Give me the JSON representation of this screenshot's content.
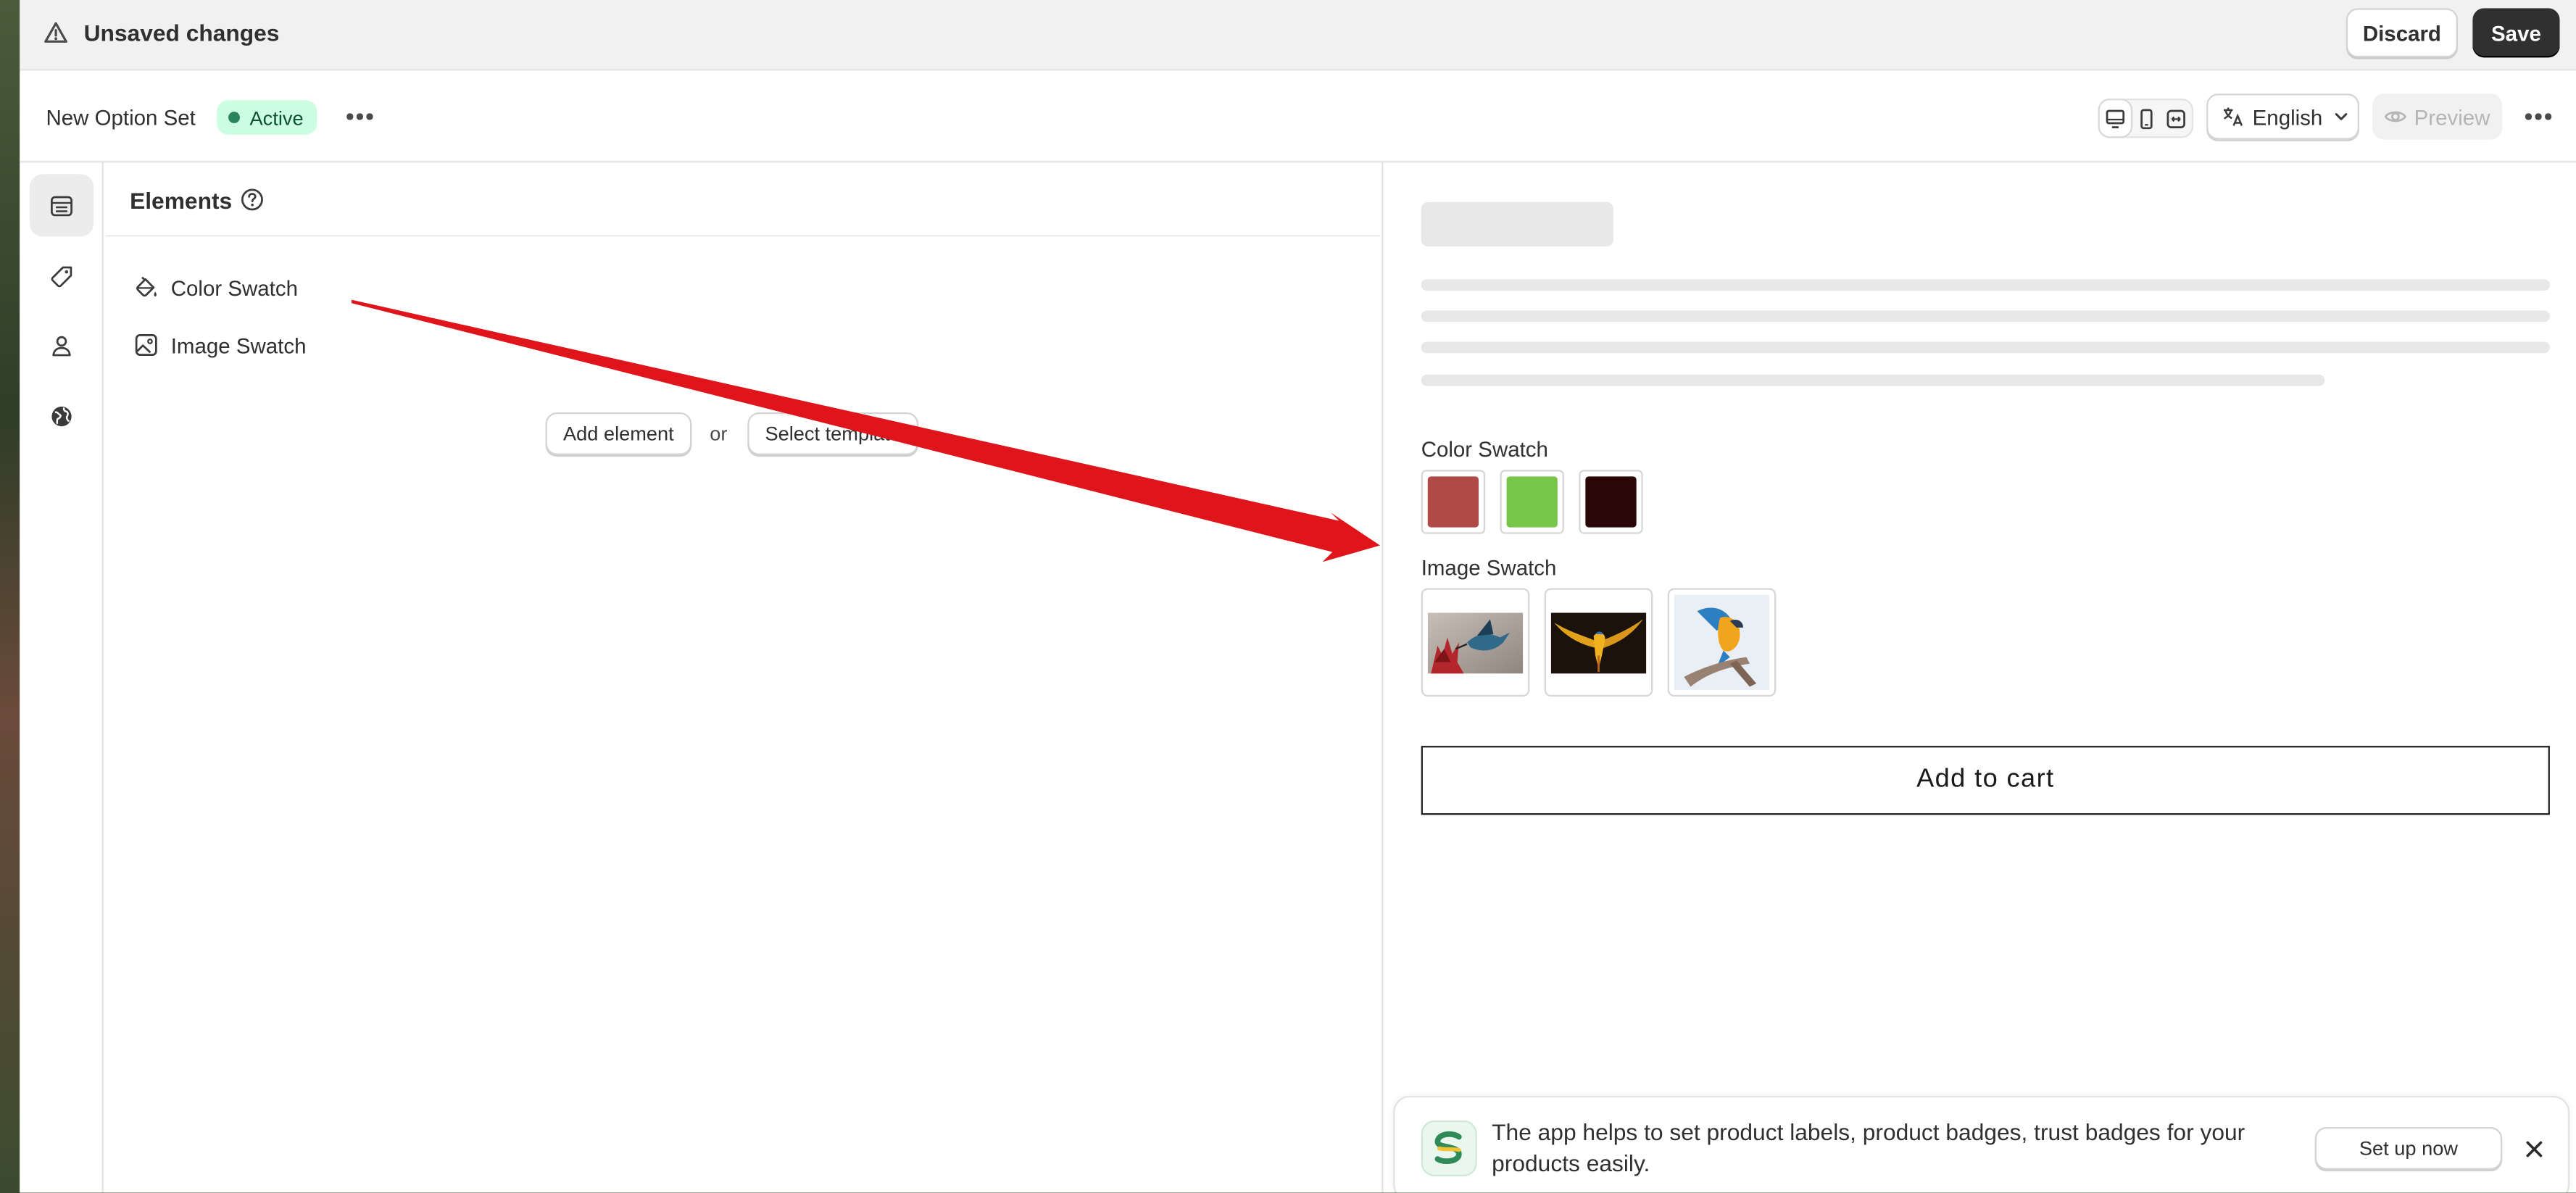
{
  "topbar": {
    "title": "Unsaved changes",
    "discard_label": "Discard",
    "save_label": "Save"
  },
  "subbar": {
    "option_set_name": "New Option Set",
    "status_badge": "Active",
    "language": "English",
    "preview_label": "Preview"
  },
  "rail": {
    "icons": [
      "elements-icon",
      "tag-icon",
      "person-icon",
      "globe-icon"
    ],
    "selected": "elements-icon"
  },
  "elements_panel": {
    "title": "Elements",
    "items": [
      {
        "label": "Color Swatch",
        "icon": "paint-bucket-icon"
      },
      {
        "label": "Image Swatch",
        "icon": "image-icon"
      }
    ],
    "add_element_label": "Add element",
    "or_label": "or",
    "select_template_label": "Select template"
  },
  "preview": {
    "color_swatch_label": "Color Swatch",
    "colors": [
      "#b04a46",
      "#77c84a",
      "#2a0606"
    ],
    "image_swatch_label": "Image Swatch",
    "images": [
      "hummingbird-on-flower-image",
      "macaw-dark-background-image",
      "macaw-on-branch-image"
    ],
    "add_to_cart_label": "Add to cart"
  },
  "banner": {
    "message": "The app helps to set product labels, product badges, trust badges for your products easily.",
    "setup_label": "Set up now"
  },
  "annotation": {
    "arrow_color": "#e0141b"
  }
}
